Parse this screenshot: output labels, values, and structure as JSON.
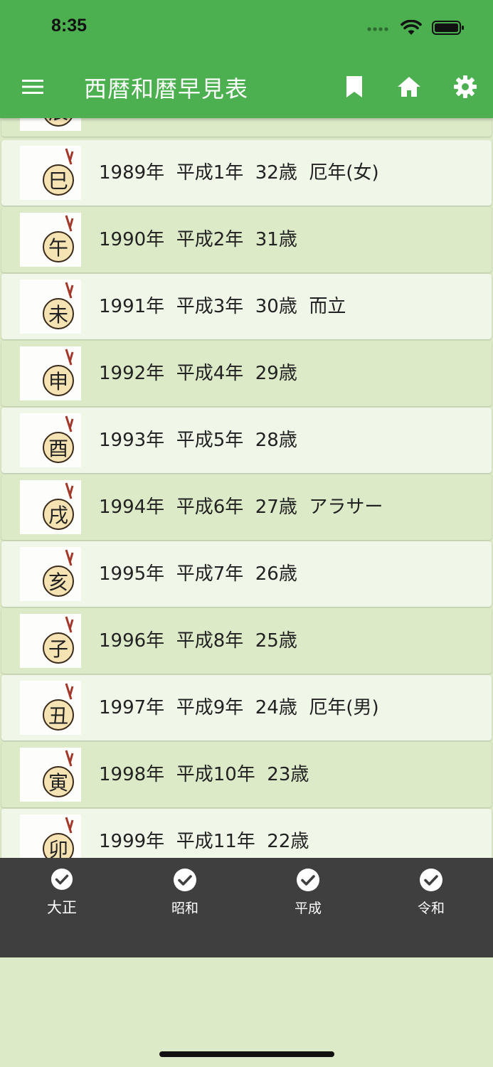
{
  "status_bar": {
    "time": "8:35"
  },
  "app_bar": {
    "title": "西暦和暦早見表",
    "menu_icon": "hamburger-menu-icon",
    "actions": [
      "bookmark-icon",
      "home-icon",
      "gear-icon"
    ]
  },
  "list": {
    "partial_top": {
      "zodiac_char": "辰"
    },
    "rows": [
      {
        "zodiac_char": "巳",
        "text": "1989年  平成1年  32歳  厄年(女)"
      },
      {
        "zodiac_char": "午",
        "text": "1990年  平成2年  31歳"
      },
      {
        "zodiac_char": "未",
        "text": "1991年  平成3年  30歳  而立"
      },
      {
        "zodiac_char": "申",
        "text": "1992年  平成4年  29歳"
      },
      {
        "zodiac_char": "酉",
        "text": "1993年  平成5年  28歳"
      },
      {
        "zodiac_char": "戌",
        "text": "1994年  平成6年  27歳  アラサー"
      },
      {
        "zodiac_char": "亥",
        "text": "1995年  平成7年  26歳"
      },
      {
        "zodiac_char": "子",
        "text": "1996年  平成8年  25歳"
      },
      {
        "zodiac_char": "丑",
        "text": "1997年  平成9年  24歳  厄年(男)"
      },
      {
        "zodiac_char": "寅",
        "text": "1998年  平成10年  23歳"
      },
      {
        "zodiac_char": "卯",
        "text": "1999年  平成11年  22歳"
      }
    ]
  },
  "tab_bar": {
    "tabs": [
      {
        "label": "大正",
        "icon": "check-circle-icon"
      },
      {
        "label": "昭和",
        "icon": "check-circle-icon"
      },
      {
        "label": "平成",
        "icon": "check-circle-icon"
      },
      {
        "label": "令和",
        "icon": "check-circle-icon"
      }
    ]
  },
  "colors": {
    "app_bar": "#4caf50",
    "row_light": "#f0f6e8",
    "row_dark": "#ddeac8",
    "tab_bar": "#3f3f3f"
  }
}
